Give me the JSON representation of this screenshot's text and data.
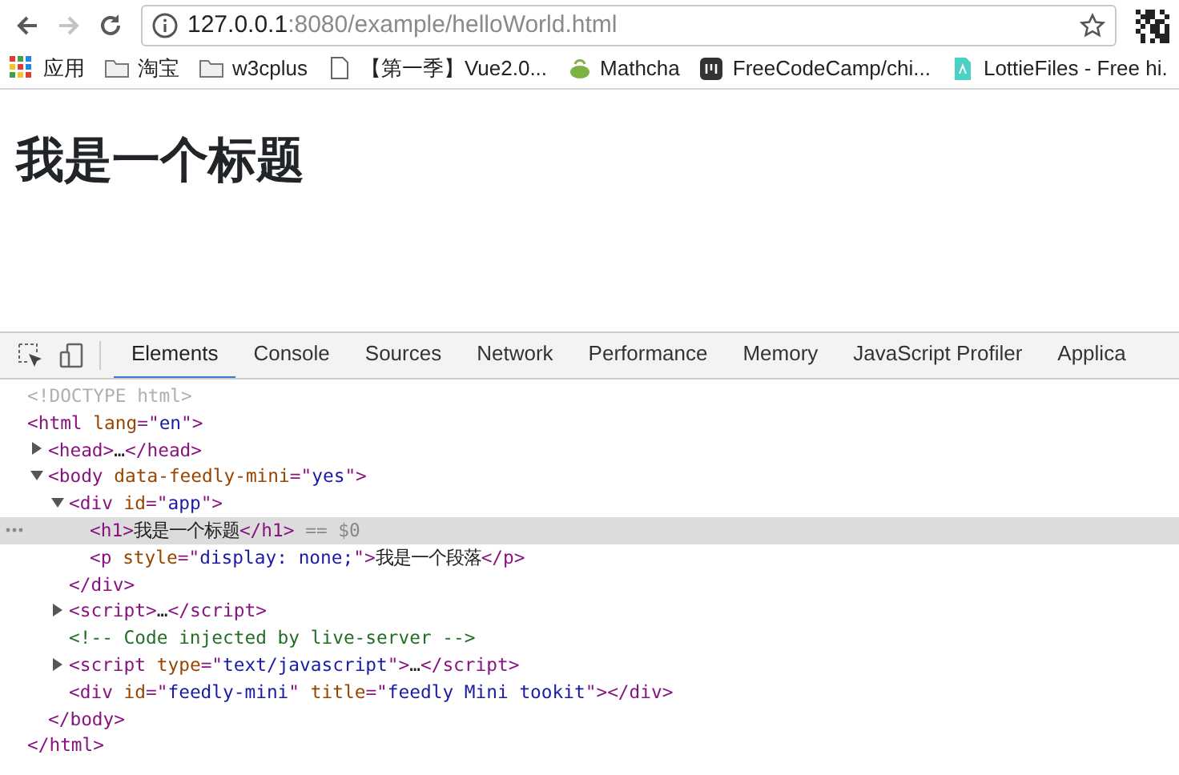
{
  "browser": {
    "nav_buttons": [
      {
        "kind": "back",
        "disabled": false
      },
      {
        "kind": "forward",
        "disabled": true
      },
      {
        "kind": "reload",
        "disabled": false
      }
    ],
    "address": {
      "host": "127.0.0.1",
      "path": ":8080/example/helloWorld.html"
    },
    "bookmarks": [
      {
        "kind": "apps",
        "label": "应用"
      },
      {
        "kind": "folder",
        "label": "淘宝"
      },
      {
        "kind": "folder",
        "label": "w3cplus"
      },
      {
        "kind": "page",
        "label": "【第一季】Vue2.0..."
      },
      {
        "kind": "teapot",
        "label": "Mathcha"
      },
      {
        "kind": "dark",
        "label": "FreeCodeCamp/chi..."
      },
      {
        "kind": "file",
        "label": "LottieFiles - Free hi."
      }
    ]
  },
  "page": {
    "heading": "我是一个标题"
  },
  "devtools": {
    "tabs": [
      {
        "label": "Elements",
        "selected": true
      },
      {
        "label": "Console",
        "selected": false
      },
      {
        "label": "Sources",
        "selected": false
      },
      {
        "label": "Network",
        "selected": false
      },
      {
        "label": "Performance",
        "selected": false
      },
      {
        "label": "Memory",
        "selected": false
      },
      {
        "label": "JavaScript Profiler",
        "selected": false
      },
      {
        "label": "Applica",
        "selected": false
      }
    ],
    "tree": [
      {
        "selected": false,
        "segments": [
          {
            "kind": "doctype",
            "text": "<!DOCTYPE html>"
          }
        ]
      },
      {
        "selected": false,
        "segments": [
          {
            "kind": "tag",
            "text": "<html"
          },
          {
            "kind": "attr",
            "text": " lang"
          },
          {
            "kind": "tag",
            "text": "=\""
          },
          {
            "kind": "value",
            "text": "en"
          },
          {
            "kind": "tag",
            "text": "\">"
          }
        ],
        "children": [
          {
            "selected": false,
            "expanded": false,
            "segments": [
              {
                "kind": "tag",
                "text": "<head>"
              },
              {
                "kind": "text",
                "text": "…"
              },
              {
                "kind": "tag",
                "text": "</head>"
              }
            ]
          },
          {
            "selected": false,
            "expanded": true,
            "segments": [
              {
                "kind": "tag",
                "text": "<body"
              },
              {
                "kind": "attr",
                "text": " data-feedly-mini"
              },
              {
                "kind": "tag",
                "text": "=\""
              },
              {
                "kind": "value",
                "text": "yes"
              },
              {
                "kind": "tag",
                "text": "\">"
              }
            ],
            "children": [
              {
                "selected": false,
                "expanded": true,
                "segments": [
                  {
                    "kind": "tag",
                    "text": "<div"
                  },
                  {
                    "kind": "attr",
                    "text": " id"
                  },
                  {
                    "kind": "tag",
                    "text": "=\""
                  },
                  {
                    "kind": "value",
                    "text": "app"
                  },
                  {
                    "kind": "tag",
                    "text": "\">"
                  }
                ],
                "children": [
                  {
                    "selected": true,
                    "segments": [
                      {
                        "kind": "tag",
                        "text": "<h1>"
                      },
                      {
                        "kind": "text",
                        "text": "我是一个标题"
                      },
                      {
                        "kind": "tag",
                        "text": "</h1>"
                      },
                      {
                        "kind": "marker",
                        "text": " == $0"
                      }
                    ]
                  },
                  {
                    "selected": false,
                    "segments": [
                      {
                        "kind": "tag",
                        "text": "<p"
                      },
                      {
                        "kind": "attr",
                        "text": " style"
                      },
                      {
                        "kind": "tag",
                        "text": "=\""
                      },
                      {
                        "kind": "value",
                        "text": "display: none;"
                      },
                      {
                        "kind": "tag",
                        "text": "\">"
                      },
                      {
                        "kind": "text",
                        "text": "我是一个段落"
                      },
                      {
                        "kind": "tag",
                        "text": "</p>"
                      }
                    ]
                  }
                ]
              },
              {
                "selected": false,
                "segments": [
                  {
                    "kind": "tag",
                    "text": "</div>"
                  }
                ]
              },
              {
                "selected": false,
                "expanded": false,
                "segments": [
                  {
                    "kind": "tag",
                    "text": "<script>"
                  },
                  {
                    "kind": "text",
                    "text": "…"
                  },
                  {
                    "kind": "tag",
                    "text": "</script>"
                  }
                ]
              },
              {
                "selected": false,
                "segments": [
                  {
                    "kind": "comment",
                    "text": "<!-- Code injected by live-server -->"
                  }
                ]
              },
              {
                "selected": false,
                "expanded": false,
                "segments": [
                  {
                    "kind": "tag",
                    "text": "<script"
                  },
                  {
                    "kind": "attr",
                    "text": " type"
                  },
                  {
                    "kind": "tag",
                    "text": "=\""
                  },
                  {
                    "kind": "value",
                    "text": "text/javascript"
                  },
                  {
                    "kind": "tag",
                    "text": "\">"
                  },
                  {
                    "kind": "text",
                    "text": "…"
                  },
                  {
                    "kind": "tag",
                    "text": "</script>"
                  }
                ]
              },
              {
                "selected": false,
                "segments": [
                  {
                    "kind": "tag",
                    "text": "<div"
                  },
                  {
                    "kind": "attr",
                    "text": " id"
                  },
                  {
                    "kind": "tag",
                    "text": "=\""
                  },
                  {
                    "kind": "value",
                    "text": "feedly-mini"
                  },
                  {
                    "kind": "tag",
                    "text": "\""
                  },
                  {
                    "kind": "attr",
                    "text": " title"
                  },
                  {
                    "kind": "tag",
                    "text": "=\""
                  },
                  {
                    "kind": "value",
                    "text": "feedly Mini tookit"
                  },
                  {
                    "kind": "tag",
                    "text": "\"></div>"
                  }
                ]
              }
            ]
          },
          {
            "selected": false,
            "segments": [
              {
                "kind": "tag",
                "text": "</body>"
              }
            ]
          }
        ]
      },
      {
        "selected": false,
        "segments": [
          {
            "kind": "tag",
            "text": "</html>"
          }
        ]
      }
    ]
  }
}
